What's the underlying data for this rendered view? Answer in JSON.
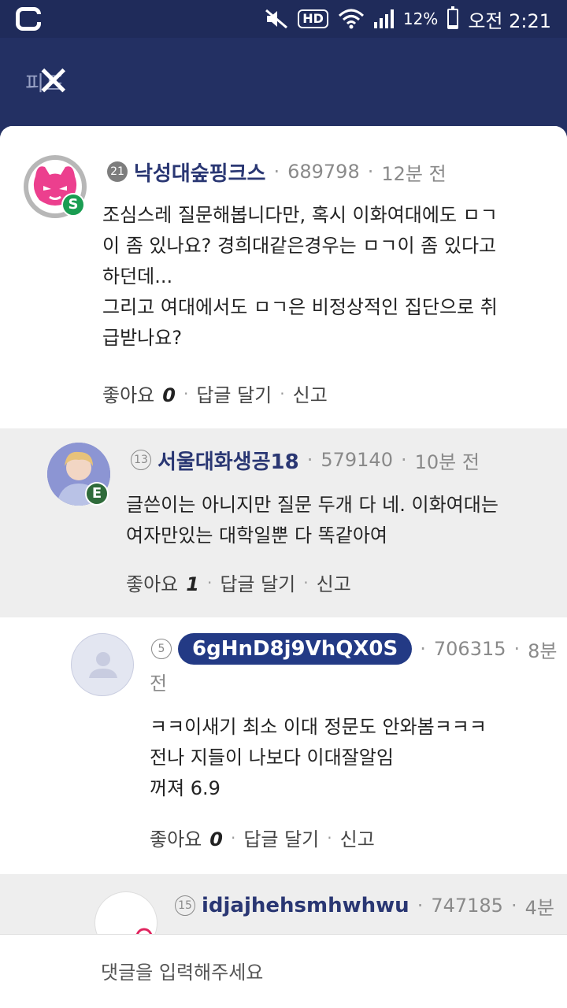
{
  "status_bar": {
    "battery_percent": "12%",
    "battery_level": 0.12,
    "time": "오전 2:21",
    "hd_label": "HD"
  },
  "top_bar": {
    "close_underlay": "피드"
  },
  "comments": [
    {
      "level": "21",
      "level_style": "filled",
      "nickname": "낙성대숲핑크스",
      "user_id": "689798",
      "time": "12분 전",
      "badge": "S",
      "text_lines": [
        "조심스레 질문해봅니다만, 혹시 이화여대에도 ㅁㄱ",
        "이 좀 있나요? 경희대같은경우는 ㅁㄱ이 좀 있다고",
        "하던데...",
        "그리고 여대에서도 ㅁㄱ은 비정상적인 집단으로 취",
        "급받나요?"
      ],
      "like_label": "좋아요",
      "like_count": "0",
      "reply_label": "답글 달기",
      "report_label": "신고"
    },
    {
      "level": "13",
      "level_style": "outline",
      "nickname": "서울대화생공18",
      "user_id": "579140",
      "time": "10분 전",
      "badge": "E",
      "text_lines": [
        "글쓴이는 아니지만 질문 두개 다 네. 이화여대는",
        "여자만있는 대학일뿐 다 똑같아여"
      ],
      "like_label": "좋아요",
      "like_count": "1",
      "reply_label": "답글 달기",
      "report_label": "신고"
    },
    {
      "level": "5",
      "level_style": "outline",
      "nickname": "6gHnD8j9VhQX0S",
      "user_id": "706315",
      "time_part1": "8분",
      "time_part2": "전",
      "text_lines": [
        "ㅋㅋ이새기 최소 이대 정문도 안와봄ㅋㅋㅋ",
        "전나 지들이 나보다 이대잘알임",
        "꺼져 6.9"
      ],
      "like_label": "좋아요",
      "like_count": "0",
      "reply_label": "답글 달기",
      "report_label": "신고"
    },
    {
      "level": "15",
      "level_style": "outline",
      "nickname": "idjajhehsmhwhwu",
      "user_id": "747185",
      "time_part1": "4분"
    }
  ],
  "input": {
    "placeholder": "댓글을 입력해주세요"
  },
  "colors": {
    "navy": "#233063",
    "nickname": "#2a3773",
    "pill": "#233a85",
    "reply_bg": "#eeeeee"
  }
}
